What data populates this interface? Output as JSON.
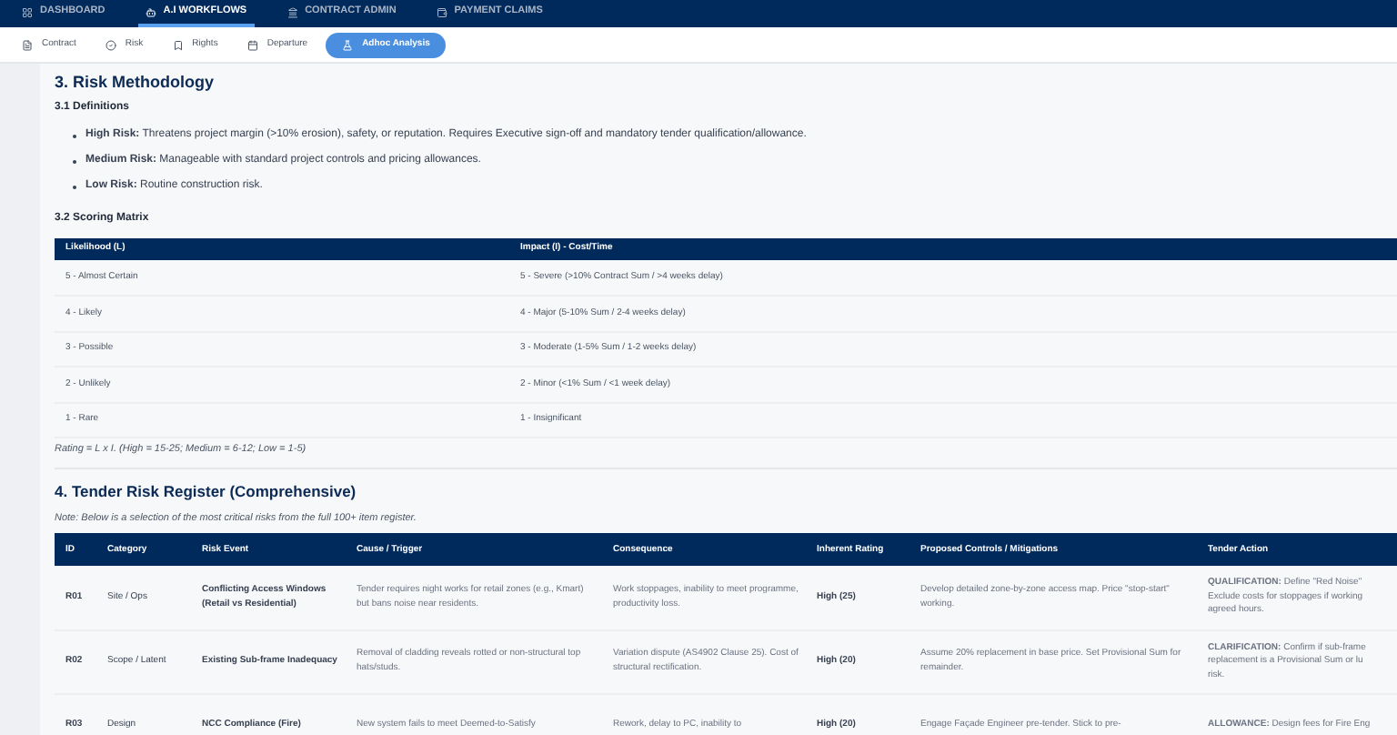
{
  "top_nav": [
    {
      "label": "DASHBOARD",
      "selected": false
    },
    {
      "label": "A.I WORKFLOWS",
      "selected": true
    },
    {
      "label": "CONTRACT ADMIN",
      "selected": false
    },
    {
      "label": "PAYMENT CLAIMS",
      "selected": false
    }
  ],
  "sub_tabs": [
    {
      "label": "Contract",
      "selected": false
    },
    {
      "label": "Risk",
      "selected": false
    },
    {
      "label": "Rights",
      "selected": false
    },
    {
      "label": "Departure",
      "selected": false
    },
    {
      "label": "Adhoc Analysis",
      "selected": true
    }
  ],
  "section_3": {
    "title": "3. Risk Methodology",
    "definitions_title": "3.1 Definitions",
    "definitions": [
      "**High Risk:** Threatens project margin (>10% erosion), safety, or reputation. Requires Executive sign-off and mandatory tender qualification/allowance.",
      "**Medium Risk:** Manageable with standard project controls and pricing allowances.",
      "**Low Risk:** Routine construction risk."
    ],
    "matrix_title": "3.2 Scoring Matrix",
    "matrix_columns": [
      "Likelihood (L)",
      "Impact (I) - Cost/Time"
    ],
    "matrix_rows": [
      [
        "5 - Almost Certain",
        "5 - Severe (>10% Contract Sum / >4 weeks delay)"
      ],
      [
        "4 - Likely",
        "4 - Major (5-10% Sum / 2-4 weeks delay)"
      ],
      [
        "3 - Possible",
        "3 - Moderate (1-5% Sum / 1-2 weeks delay)"
      ],
      [
        "2 - Unlikely",
        "2 - Minor (<1% Sum / <1 week delay)"
      ],
      [
        "1 - Rare",
        "1 - Insignificant"
      ]
    ],
    "rating_note": "Rating = L x I. (High = 15-25; Medium = 6-12; Low = 1-5)"
  },
  "section_4": {
    "title": "4. Tender Risk Register (Comprehensive)",
    "note": "Note: Below is a selection of the most critical risks from the full 100+ item register.",
    "columns": [
      "ID",
      "Category",
      "Risk Event",
      "Cause / Trigger",
      "Consequence",
      "Inherent Rating",
      "Proposed Controls / Mitigations",
      "Tender Action"
    ],
    "rows": [
      {
        "id": "R01",
        "category": "Site / Ops",
        "risk_event": "Conflicting Access Windows (Retail vs Residential)",
        "cause": "Tender requires night works for retail zones (e.g., Kmart) but bans noise near residents.",
        "consequence": "Work stoppages, inability to meet programme, productivity loss.",
        "rating": "High (25)",
        "controls": "Develop detailed zone-by-zone access map. Price \"stop-start\" working.",
        "tender_action": [
          "**QUALIFICATION:** Define \"Red Noise\"",
          "Exclude costs for stoppages if working",
          "agreed hours."
        ]
      },
      {
        "id": "R02",
        "category": "Scope / Latent",
        "risk_event": "Existing Sub-frame Inadequacy",
        "cause": "Removal of cladding reveals rotted or non-structural top hats/studs.",
        "consequence": "Variation dispute (AS4902 Clause 25). Cost of structural rectification.",
        "rating": "High (20)",
        "controls": "Assume 20% replacement in base price. Set Provisional Sum for remainder.",
        "tender_action": [
          "**CLARIFICATION:** Confirm if sub-frame",
          "replacement is a Provisional Sum or lu",
          "risk."
        ]
      },
      {
        "id": "R03",
        "category": "Design",
        "risk_event": "NCC Compliance (Fire)",
        "cause": "New system fails to meet Deemed-to-Satisfy",
        "consequence": "Rework, delay to PC, inability to",
        "rating": "High (20)",
        "controls": "Engage Façade Engineer pre-tender. Stick to pre-",
        "tender_action": [
          "**ALLOWANCE:** Design fees for Fire Eng"
        ]
      }
    ]
  }
}
